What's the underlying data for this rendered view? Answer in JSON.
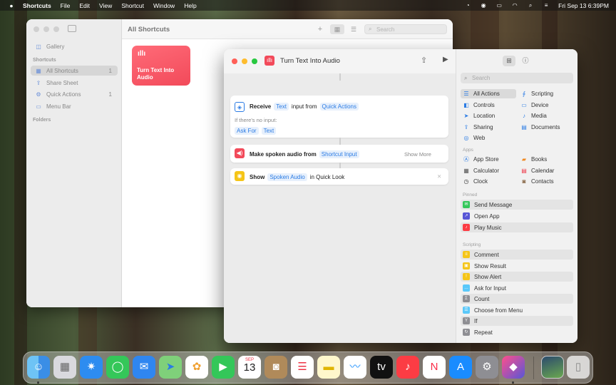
{
  "menubar": {
    "app_name": "Shortcuts",
    "menus": [
      "File",
      "Edit",
      "View",
      "Shortcut",
      "Window",
      "Help"
    ],
    "datetime": "Fri Sep 13  6:39PM"
  },
  "main_window": {
    "sidebar": {
      "gallery": "Gallery",
      "section_shortcuts": "Shortcuts",
      "items": [
        {
          "label": "All Shortcuts",
          "count": "1"
        },
        {
          "label": "Share Sheet",
          "count": ""
        },
        {
          "label": "Quick Actions",
          "count": "1"
        },
        {
          "label": "Menu Bar",
          "count": ""
        }
      ],
      "section_folders": "Folders"
    },
    "title": "All Shortcuts",
    "search_placeholder": "Search",
    "tile": {
      "name": "Turn Text Into Audio",
      "color": "#f24a5a"
    }
  },
  "editor": {
    "title": "Turn Text Into Audio",
    "actions": {
      "receive": {
        "verb": "Receive",
        "token1": "Text",
        "middle": "input from",
        "token2": "Quick Actions",
        "no_input_label": "If there's no input:",
        "no_input_token1": "Ask For",
        "no_input_token2": "Text"
      },
      "speak": {
        "label": "Make spoken audio from",
        "token": "Shortcut Input",
        "show_more": "Show More"
      },
      "show": {
        "verb": "Show",
        "token": "Spoken Audio",
        "tail": "in Quick Look"
      }
    }
  },
  "library": {
    "search_placeholder": "Search",
    "categories": [
      {
        "label": "All Actions",
        "icon": "list-icon"
      },
      {
        "label": "Scripting",
        "icon": "scripting-icon"
      },
      {
        "label": "Controls",
        "icon": "controls-icon"
      },
      {
        "label": "Device",
        "icon": "device-icon"
      },
      {
        "label": "Location",
        "icon": "location-icon"
      },
      {
        "label": "Media",
        "icon": "media-icon"
      },
      {
        "label": "Sharing",
        "icon": "sharing-icon"
      },
      {
        "label": "Documents",
        "icon": "documents-icon"
      },
      {
        "label": "Web",
        "icon": "web-icon"
      }
    ],
    "section_apps": "Apps",
    "apps": [
      "App Store",
      "Books",
      "Calculator",
      "Calendar",
      "Clock",
      "Contacts"
    ],
    "section_pinned": "Pinned",
    "pinned": [
      "Send Message",
      "Open App",
      "Play Music"
    ],
    "section_scripting": "Scripting",
    "scripting": [
      "Comment",
      "Show Result",
      "Show Alert",
      "Ask for Input",
      "Count",
      "Choose from Menu",
      "If",
      "Repeat"
    ]
  },
  "dock": {
    "apps": [
      "Finder",
      "Launchpad",
      "Safari",
      "Messages",
      "Mail",
      "Maps",
      "Photos",
      "FaceTime",
      "Calendar",
      "Contacts",
      "Reminders",
      "Notes",
      "Freeform",
      "TV",
      "Music",
      "News",
      "App Store",
      "System Settings",
      "Shortcuts",
      "Desktop",
      "Trash"
    ],
    "calendar_month": "SEP",
    "calendar_day": "13"
  }
}
